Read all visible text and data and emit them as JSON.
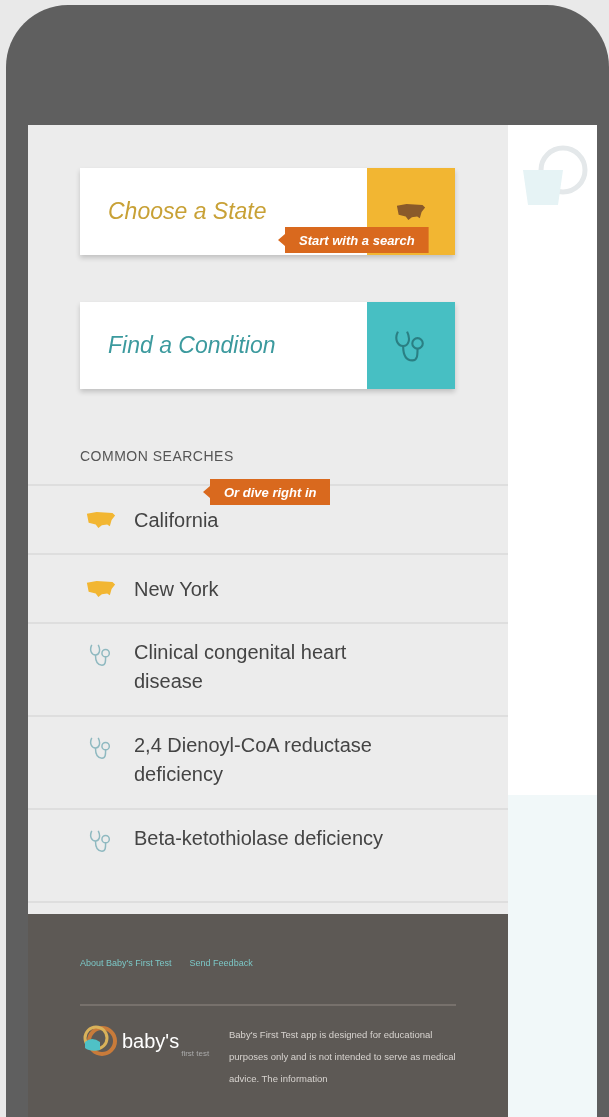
{
  "search_cards": [
    {
      "kind": "state",
      "label": "Choose a State",
      "tooltip": "Start with a search"
    },
    {
      "kind": "condition",
      "label": "Find a Condition"
    }
  ],
  "common_searches": {
    "title": "COMMON SEARCHES",
    "tooltip": "Or dive right in",
    "items": [
      {
        "kind": "state",
        "label": "California"
      },
      {
        "kind": "state",
        "label": "New York"
      },
      {
        "kind": "condition",
        "label": "Clinical congenital heart disease"
      },
      {
        "kind": "condition",
        "label": "2,4 Dienoyl-CoA reductase deficiency"
      },
      {
        "kind": "condition",
        "label": "Beta-ketothiolase deficiency"
      }
    ]
  },
  "footer": {
    "links": [
      "About Baby's First Test",
      "Send Feedback"
    ],
    "logo": {
      "name": "baby's",
      "tagline": "first test"
    },
    "disclaimer": "Baby's First Test app is designed for educational purposes only and is not intended to serve as medical advice. The information"
  }
}
